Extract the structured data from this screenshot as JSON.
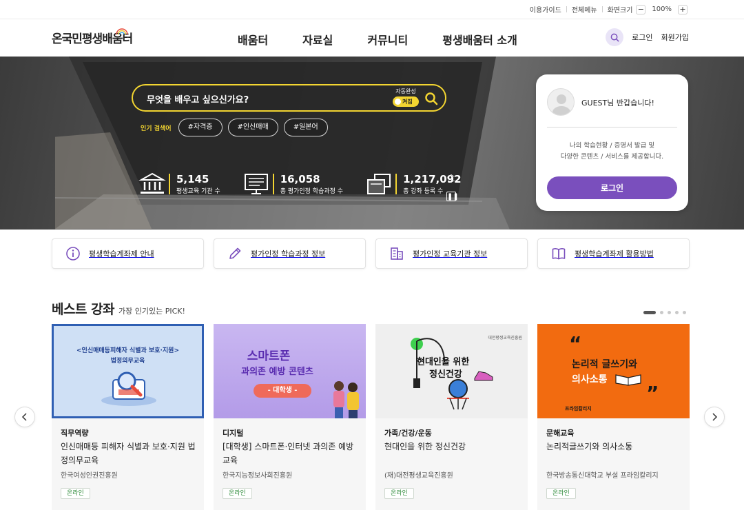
{
  "utility": {
    "guide": "이용가이드",
    "sitemap": "전체메뉴",
    "zoom_label": "화면크기",
    "zoom_value": "100%",
    "zoom_minus": "−",
    "zoom_plus": "+"
  },
  "header": {
    "logo": "온국민평생배움터",
    "nav": [
      "배움터",
      "자료실",
      "커뮤니티",
      "평생배움터 소개"
    ],
    "login": "로그인",
    "signup": "회원가입"
  },
  "hero": {
    "search_placeholder": "무엇을 배우고 싶으신가요?",
    "autocomplete_label": "자동완성",
    "autocomplete_state": "켜짐",
    "popular_label": "인기 검색어",
    "popular_tags": [
      "#자격증",
      "#인신매매",
      "#일본어"
    ],
    "stats": [
      {
        "value": "5,145",
        "caption": "평생교육 기관 수",
        "icon": "institution-icon"
      },
      {
        "value": "16,058",
        "caption": "총 평가인정 학습과정 수",
        "icon": "monitor-list-icon"
      },
      {
        "value": "1,217,092",
        "caption": "총 강좌 등록 수",
        "icon": "folders-icon"
      }
    ]
  },
  "login_card": {
    "greeting": "GUEST님 반갑습니다!",
    "desc_line1": "나의 학습현황 / 증명서 발급 및",
    "desc_line2": "다양한 콘텐츠 / 서비스를 제공합니다.",
    "button": "로그인"
  },
  "quick_links": [
    {
      "label": "평생학습계좌제 안내",
      "icon": "info-icon"
    },
    {
      "label": "평가인정 학습과정 정보",
      "icon": "pencil-icon"
    },
    {
      "label": "평가인정 교육기관 정보",
      "icon": "building-icon"
    },
    {
      "label": "평생학습계좌제 활용방법",
      "icon": "book-icon"
    }
  ],
  "best": {
    "title": "베스트 강좌",
    "subtitle": "가장 인기있는 PICK!",
    "cards": [
      {
        "category": "직무역량",
        "title": "인신매매등 피해자 식별과 보호·지원 법정의무교육",
        "org": "한국여성인권진흥원",
        "badge": "온라인",
        "thumb_line1": "<인신매매등피해자 식별과 보호·지원>",
        "thumb_line2": "법정의무교육"
      },
      {
        "category": "디지털",
        "title": "[대학생] 스마트폰·인터넷 과의존 예방 교육",
        "org": "한국지능정보사회진흥원",
        "badge": "온라인",
        "thumb_line1": "스마트폰",
        "thumb_line2": "과의존 예방 콘텐츠",
        "thumb_line3": "- 대학생 -"
      },
      {
        "category": "가족/건강/운동",
        "title": "현대인을 위한 정신건강",
        "org": "(재)대전평생교육진흥원",
        "badge": "온라인",
        "thumb_line1": "현대인을 위한",
        "thumb_line2": "정신건강",
        "thumb_org": "대전평생교육진흥원"
      },
      {
        "category": "문해교육",
        "title": "논리적글쓰기와 의사소통",
        "org": "한국방송통신대학교 부설 프라임칼리지",
        "badge": "온라인",
        "thumb_line1": "논리적 글쓰기와",
        "thumb_line2": "의사소통",
        "thumb_org": "프라임칼리지"
      }
    ]
  }
}
